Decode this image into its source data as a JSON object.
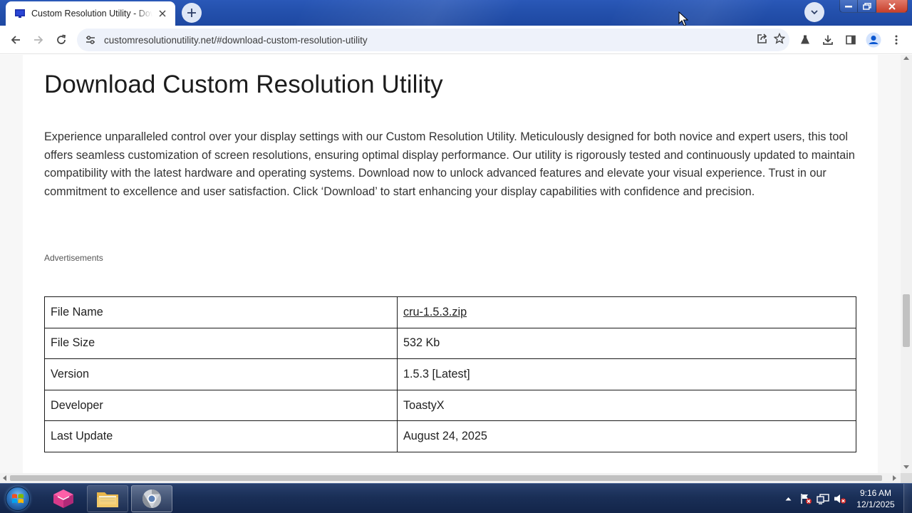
{
  "browser": {
    "tab": {
      "title": "Custom Resolution Utility - Download",
      "favicon": "monitor-icon",
      "close_icon": "close-icon"
    },
    "new_tab_icon": "plus-icon",
    "tab_search_icon": "chevron-down-icon",
    "window_controls": [
      "minimize-icon",
      "maximize-icon",
      "close-icon"
    ],
    "toolbar": {
      "back_icon": "arrow-left-icon",
      "forward_icon": "arrow-right-icon",
      "reload_icon": "reload-icon",
      "site_info_icon": "tune-icon",
      "url": "customresolutionutility.net/#download-custom-resolution-utility",
      "share_icon": "share-icon",
      "bookmark_icon": "star-icon",
      "extensions_icon": "labs-icon",
      "downloads_icon": "download-icon",
      "side_panel_icon": "side-panel-icon",
      "profile_icon": "profile-icon",
      "menu_icon": "kebab-menu-icon"
    }
  },
  "page": {
    "title": "Download Custom Resolution Utility",
    "description": "Experience unparalleled control over your display settings with our Custom Resolution Utility. Meticulously designed for both novice and expert users, this tool offers seamless customization of screen resolutions, ensuring optimal display performance. Our utility is rigorously tested and continuously updated to maintain compatibility with the latest hardware and operating systems. Download now to unlock advanced features and elevate your visual experience. Trust in our commitment to excellence and user satisfaction. Click ‘Download’ to start enhancing your display capabilities with confidence and precision.",
    "ads_label": "Advertisements",
    "info_table": [
      {
        "key": "File Name",
        "value": "cru-1.5.3.zip",
        "is_link": true
      },
      {
        "key": "File Size",
        "value": "532 Kb"
      },
      {
        "key": "Version",
        "value": "1.5.3 [Latest]"
      },
      {
        "key": "Developer",
        "value": "ToastyX"
      },
      {
        "key": "Last Update",
        "value": "August 24, 2025"
      }
    ]
  },
  "taskbar": {
    "start_icon": "windows-start-icon",
    "apps": [
      "app-cube-icon",
      "folder-icon",
      "chrome-icon"
    ],
    "tray_icons": [
      "tray-expand-icon",
      "action-center-flag-icon",
      "network-icon",
      "volume-muted-icon"
    ],
    "time": "9:16 AM",
    "date": "12/1/2025"
  },
  "colors": {
    "titlebar": "#2451ad",
    "taskbar": "#1a2f57",
    "omnibox": "#eef2fa",
    "text": "#333333"
  }
}
